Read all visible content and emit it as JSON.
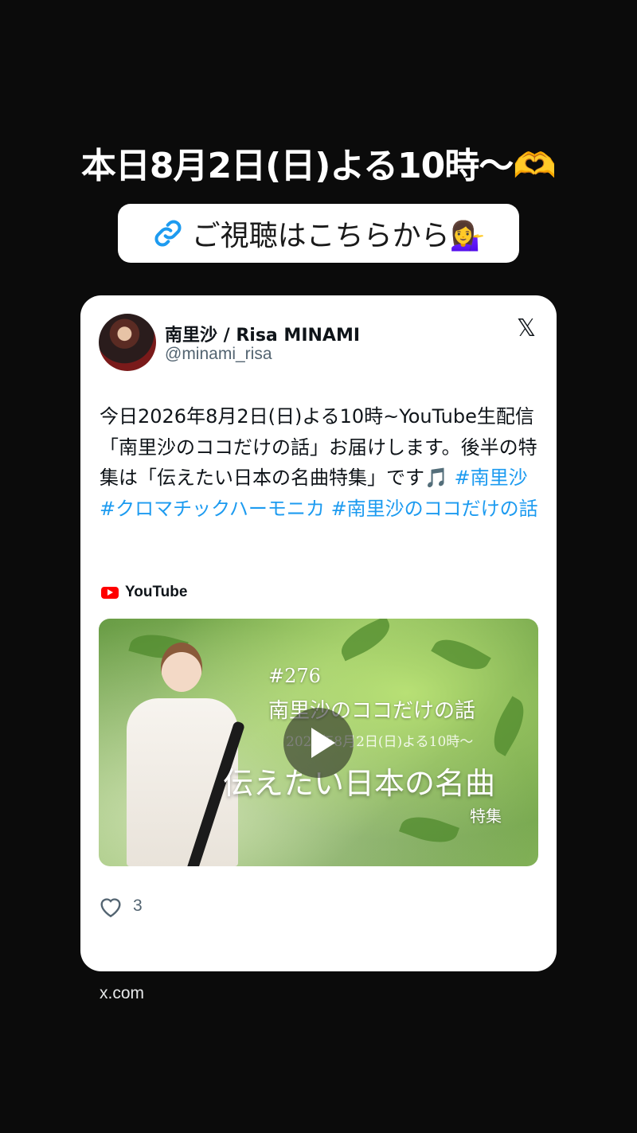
{
  "headline": "本日8月2日(日)よる10時〜🫶",
  "link_pill": {
    "label": "ご視聴はこちらから💁‍♀️",
    "icon": "link-icon"
  },
  "post": {
    "user_name": "南里沙 / Risa MINAMI",
    "user_handle": "@minami_risa",
    "platform_icon": "x-logo-icon",
    "text_plain": "今日2026年8月2日(日)よる10時~YouTube生配信「南里沙のココだけの話」お届けします。後半の特集は「伝えたい日本の名曲特集」です🎵",
    "hashtags": [
      "#南里沙",
      "#クロマチックハーモニカ",
      "#南里沙のココだけの話"
    ],
    "embed_source": "YouTube",
    "video": {
      "episode": "#276",
      "series": "南里沙のココだけの話",
      "date": "2026年8月2日(日)よる10時〜",
      "title": "伝えたい日本の名曲",
      "subtitle": "特集"
    },
    "like_count": "3"
  },
  "domain": "x.com",
  "colors": {
    "background": "#0b0b0b",
    "card": "#ffffff",
    "hashtag": "#1d9bf0",
    "link_icon": "#1d9bf0",
    "youtube_red": "#ff0000"
  }
}
